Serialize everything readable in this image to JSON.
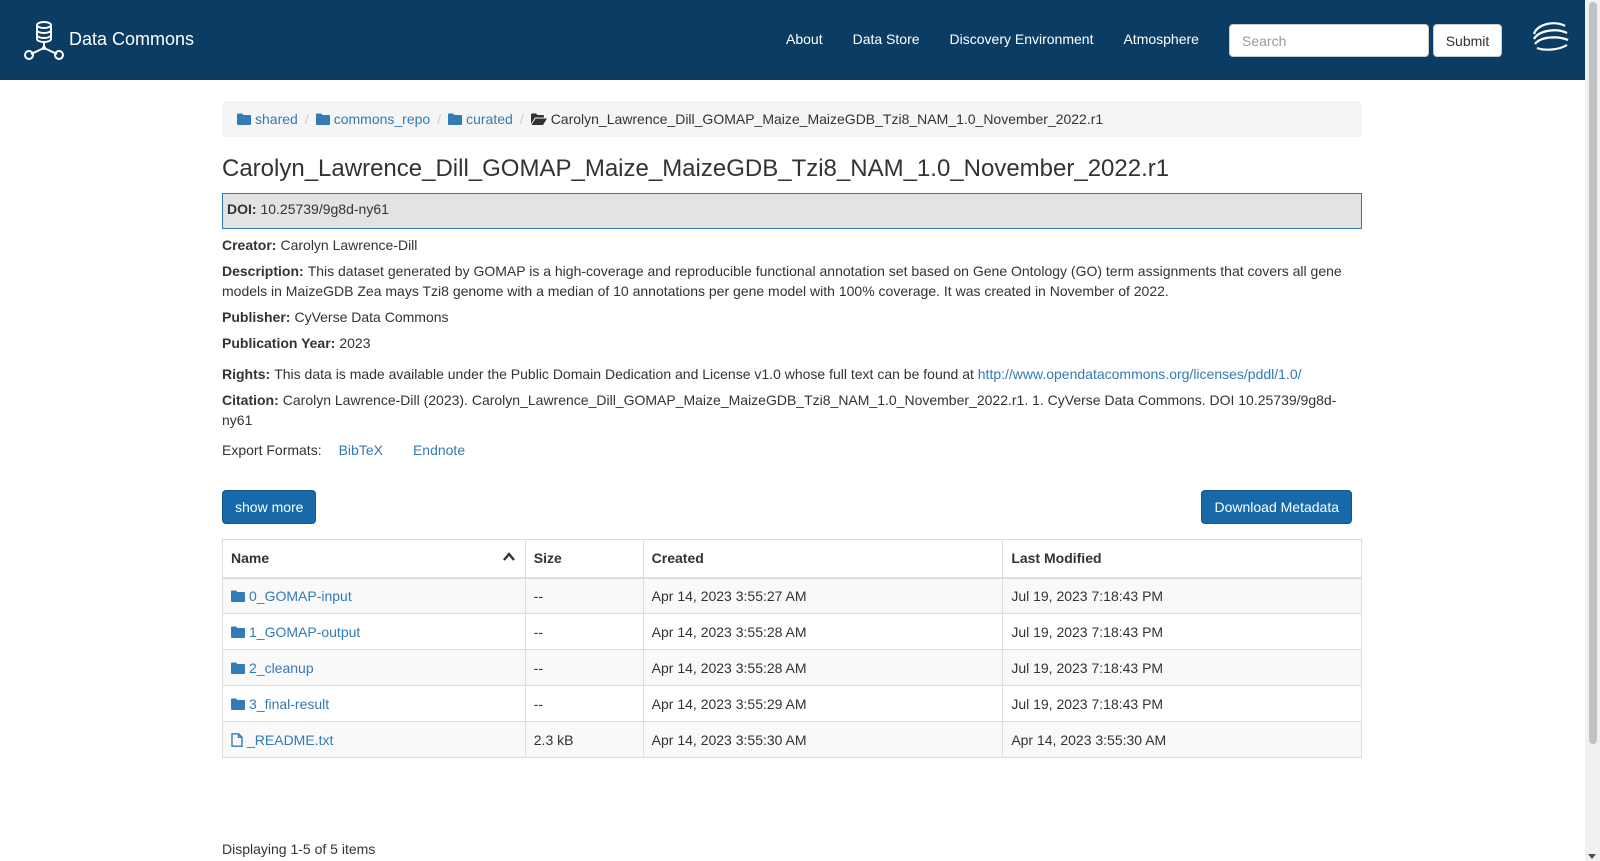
{
  "navbar": {
    "brand": "Data Commons",
    "links": [
      "About",
      "Data Store",
      "Discovery Environment",
      "Atmosphere"
    ],
    "search_placeholder": "Search",
    "submit_label": "Submit",
    "bg_color": "#0b3d64"
  },
  "breadcrumb": {
    "items": [
      "shared",
      "commons_repo",
      "curated"
    ],
    "current": "Carolyn_Lawrence_Dill_GOMAP_Maize_MaizeGDB_Tzi8_NAM_1.0_November_2022.r1"
  },
  "title": "Carolyn_Lawrence_Dill_GOMAP_Maize_MaizeGDB_Tzi8_NAM_1.0_November_2022.r1",
  "metadata": {
    "doi_label": "DOI:",
    "doi_value": "10.25739/9g8d-ny61",
    "creator_label": "Creator:",
    "creator_value": "Carolyn Lawrence-Dill",
    "description_label": "Description:",
    "description_value": "This dataset generated by GOMAP is a high-coverage and reproducible functional annotation set based on Gene Ontology (GO) term assignments that covers all gene models in MaizeGDB Zea mays Tzi8 genome with a median of 10 annotations per gene model with 100% coverage. It was created in November of 2022.",
    "publisher_label": "Publisher:",
    "publisher_value": "CyVerse Data Commons",
    "year_label": "Publication Year:",
    "year_value": "2023",
    "rights_label": "Rights:",
    "rights_value": "This data is made available under the Public Domain Dedication and License v1.0 whose full text can be found at",
    "rights_link": "http://www.opendatacommons.org/licenses/pddl/1.0/",
    "citation_label": "Citation:",
    "citation_value": "Carolyn Lawrence-Dill (2023). Carolyn_Lawrence_Dill_GOMAP_Maize_MaizeGDB_Tzi8_NAM_1.0_November_2022.r1. 1. CyVerse Data Commons. DOI 10.25739/9g8d-ny61"
  },
  "export": {
    "label": "Export Formats:",
    "formats": [
      "BibTeX",
      "Endnote"
    ]
  },
  "buttons": {
    "show_more": "show more",
    "download_metadata": "Download Metadata"
  },
  "table": {
    "headers": [
      "Name",
      "Size",
      "Created",
      "Last Modified"
    ],
    "rows": [
      {
        "type": "folder",
        "name": "0_GOMAP-input",
        "size": "--",
        "created": "Apr 14, 2023 3:55:27 AM",
        "modified": "Jul 19, 2023 7:18:43 PM"
      },
      {
        "type": "folder",
        "name": "1_GOMAP-output",
        "size": "--",
        "created": "Apr 14, 2023 3:55:28 AM",
        "modified": "Jul 19, 2023 7:18:43 PM"
      },
      {
        "type": "folder",
        "name": "2_cleanup",
        "size": "--",
        "created": "Apr 14, 2023 3:55:28 AM",
        "modified": "Jul 19, 2023 7:18:43 PM"
      },
      {
        "type": "folder",
        "name": "3_final-result",
        "size": "--",
        "created": "Apr 14, 2023 3:55:29 AM",
        "modified": "Jul 19, 2023 7:18:43 PM"
      },
      {
        "type": "file",
        "name": "_README.txt",
        "size": "2.3 kB",
        "created": "Apr 14, 2023 3:55:30 AM",
        "modified": "Apr 14, 2023 3:55:30 AM"
      }
    ]
  },
  "footer": {
    "count": "Displaying 1-5 of 5 items"
  }
}
